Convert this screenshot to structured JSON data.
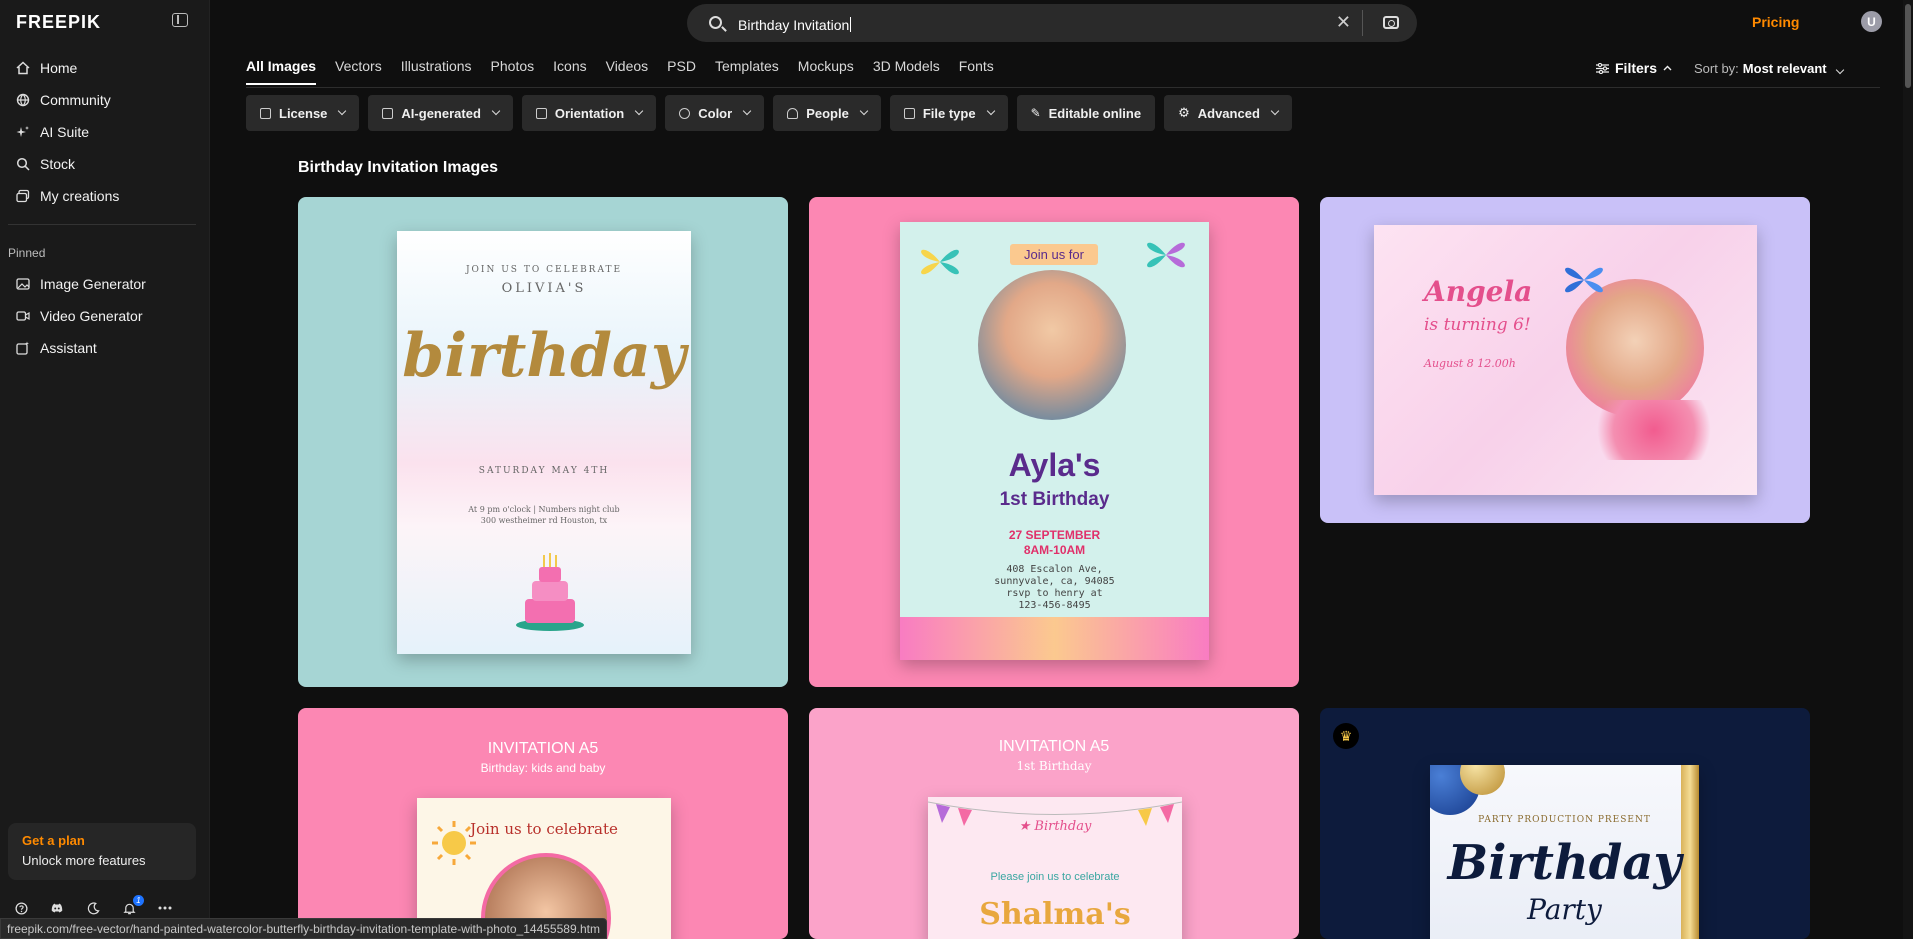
{
  "brand": {
    "logo_text": "FREEPIK",
    "accent": "#ff8a00",
    "link_accent": "#1e73ff"
  },
  "sidebar": {
    "items": [
      {
        "label": "Home",
        "icon": "home-icon"
      },
      {
        "label": "Community",
        "icon": "globe-icon"
      },
      {
        "label": "AI Suite",
        "icon": "sparkle-icon"
      },
      {
        "label": "Stock",
        "icon": "search-icon"
      },
      {
        "label": "My creations",
        "icon": "folders-icon"
      }
    ],
    "pinned_title": "Pinned",
    "pinned": [
      {
        "label": "Image Generator",
        "icon": "image-icon"
      },
      {
        "label": "Video Generator",
        "icon": "video-icon"
      },
      {
        "label": "Assistant",
        "icon": "assistant-icon"
      }
    ],
    "plan": {
      "title": "Get a plan",
      "subtitle": "Unlock more features"
    },
    "notifications_count": "1"
  },
  "header": {
    "search_value": "Birthday Invitation",
    "pricing_label": "Pricing",
    "avatar_initial": "U"
  },
  "tabs": [
    "All Images",
    "Vectors",
    "Illustrations",
    "Photos",
    "Icons",
    "Videos",
    "PSD",
    "Templates",
    "Mockups",
    "3D Models",
    "Fonts"
  ],
  "toolbar": {
    "filters_label": "Filters",
    "sort_prefix": "Sort by:",
    "sort_value": "Most relevant"
  },
  "chips": [
    "License",
    "AI-generated",
    "Orientation",
    "Color",
    "People",
    "File type",
    "Editable online",
    "Advanced"
  ],
  "section_title": "Birthday Invitation Images",
  "cards": {
    "c1": {
      "top": "JOIN US TO CELEBRATE",
      "name": "OLIVIA'S",
      "word": "birthday",
      "date": "SATURDAY MAY 4TH",
      "addr1": "At 9 pm o'clock | Numbers night club",
      "addr2": "300 westheimer rd Houston, tx"
    },
    "c2": {
      "join": "Join us for",
      "name": "Ayla's",
      "sub": "1st Birthday",
      "date1": "27 SEPTEMBER",
      "date2": "8AM-10AM",
      "addr1": "408 Escalon Ave,",
      "addr2": "sunnyvale, ca, 94085",
      "addr3": "rsvp to henry at",
      "addr4": "123-456-8495"
    },
    "c3": {
      "name": "Angela",
      "turning": "is turning 6!",
      "date": "August  8  12.00h"
    },
    "c4": {
      "title": "INVITATION A5",
      "sub": "Birthday: kids and baby",
      "inner": "Join us to celebrate"
    },
    "c5": {
      "title": "INVITATION A5",
      "sub": "1st Birthday",
      "inner": "Please join us to celebrate",
      "name": "Shalma's"
    },
    "c6": {
      "pp": "PARTY PRODUCTION PRESENT",
      "b": "Birthday",
      "p": "Party"
    }
  },
  "status_url": "freepik.com/free-vector/hand-painted-watercolor-butterfly-birthday-invitation-template-with-photo_14455589.htm"
}
